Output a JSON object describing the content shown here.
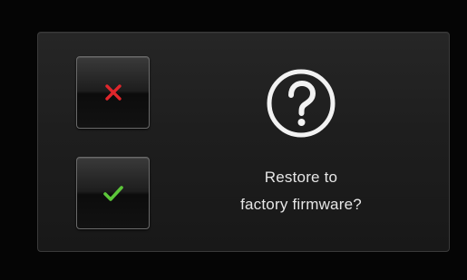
{
  "dialog": {
    "message_line1": "Restore to",
    "message_line2": "factory firmware?",
    "icon": "question-circle-icon"
  },
  "buttons": {
    "cancel": {
      "icon": "close-icon",
      "color": "#e0262c"
    },
    "confirm": {
      "icon": "checkmark-icon",
      "color": "#5cc63a"
    }
  },
  "colors": {
    "background": "#050505",
    "panel": "#1e1e1e",
    "text": "#e6e6e6"
  }
}
